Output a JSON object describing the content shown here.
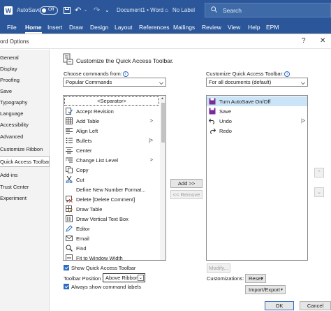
{
  "titlebar": {
    "autosave_label": "AutoSave",
    "autosave_state": "Off",
    "doc_name": "Document1 • Word",
    "label_status": "No Label",
    "search_placeholder": "Search"
  },
  "ribbon_tabs": [
    "File",
    "Home",
    "Insert",
    "Draw",
    "Design",
    "Layout",
    "References",
    "Mailings",
    "Review",
    "View",
    "Help",
    "EPM"
  ],
  "dialog": {
    "title": "ord Options",
    "help": "?",
    "close": "✕"
  },
  "nav": [
    "General",
    "Display",
    "Proofing",
    "Save",
    "Typography",
    "Language",
    "Accessibility",
    "Advanced",
    "Customize Ribbon",
    "Quick Access Toolbar",
    "Add-ins",
    "Trust Center",
    "Experiment"
  ],
  "main": {
    "heading": "Customize the Quick Access Toolbar.",
    "choose_label": "Choose commands from:",
    "choose_value": "Popular Commands",
    "customize_label": "Customize Quick Access Toolbar:",
    "customize_value": "For all documents (default)",
    "commands": [
      {
        "label": "<Separator>",
        "icon": "separator",
        "chevron": ""
      },
      {
        "label": "Accept Revision",
        "icon": "accept-revision-icon",
        "chevron": ""
      },
      {
        "label": "Add Table",
        "icon": "table-icon",
        "chevron": ">"
      },
      {
        "label": "Align Left",
        "icon": "align-left-icon",
        "chevron": ""
      },
      {
        "label": "Bullets",
        "icon": "bullets-icon",
        "chevron": "|>"
      },
      {
        "label": "Center",
        "icon": "align-center-icon",
        "chevron": ""
      },
      {
        "label": "Change List Level",
        "icon": "list-level-icon",
        "chevron": ">"
      },
      {
        "label": "Copy",
        "icon": "copy-icon",
        "chevron": ""
      },
      {
        "label": "Cut",
        "icon": "scissors-icon",
        "chevron": ""
      },
      {
        "label": "Define New Number Format...",
        "icon": "none",
        "chevron": ""
      },
      {
        "label": "Delete [Delete Comment]",
        "icon": "delete-comment-icon",
        "chevron": ""
      },
      {
        "label": "Draw Table",
        "icon": "draw-table-icon",
        "chevron": ""
      },
      {
        "label": "Draw Vertical Text Box",
        "icon": "text-box-icon",
        "chevron": ""
      },
      {
        "label": "Editor",
        "icon": "editor-icon",
        "chevron": ""
      },
      {
        "label": "Email",
        "icon": "email-icon",
        "chevron": ""
      },
      {
        "label": "Find",
        "icon": "find-icon",
        "chevron": ""
      },
      {
        "label": "Fit to Window Width",
        "icon": "fit-width-icon",
        "chevron": ""
      }
    ],
    "toolbar_items": [
      {
        "label": "Turn AutoSave On/Off",
        "icon": "autosave-icon",
        "chevron": ""
      },
      {
        "label": "Save",
        "icon": "save-icon",
        "chevron": ""
      },
      {
        "label": "Undo",
        "icon": "undo-icon",
        "chevron": "|>"
      },
      {
        "label": "Redo",
        "icon": "redo-icon",
        "chevron": ""
      }
    ],
    "add_label": "Add >>",
    "remove_label": "<< Remove",
    "modify_label": "Modify...",
    "show_qat_label": "Show Quick Access Toolbar",
    "position_label": "Toolbar Position",
    "position_value": "Above Ribbon",
    "show_labels_label": "Always show command labels",
    "customizations_label": "Customizations:",
    "reset_label": "Reset",
    "import_export_label": "Import/Export",
    "ok_label": "OK",
    "cancel_label": "Cancel"
  },
  "colors": {
    "word_blue": "#2b579a",
    "accent": "#2b6cc4"
  }
}
